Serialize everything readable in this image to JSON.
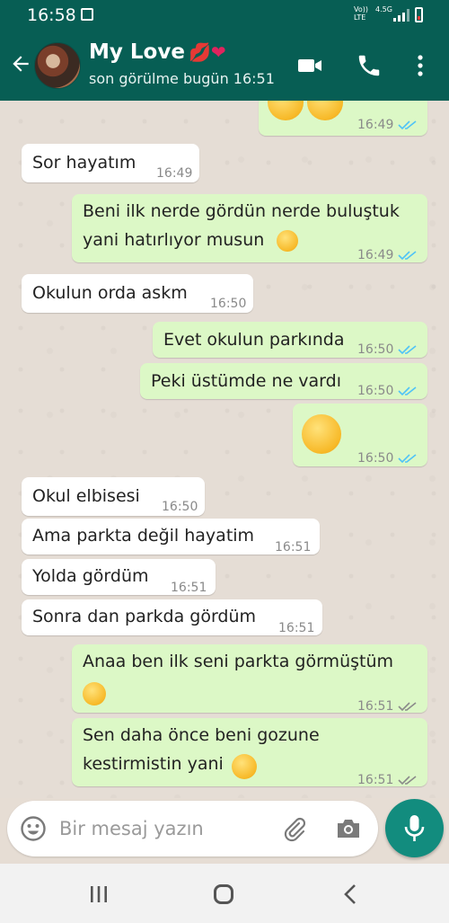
{
  "status_bar": {
    "time": "16:58",
    "net_line1": "Vo))",
    "net_line2": "LTE",
    "net_speed": "4.5G"
  },
  "header": {
    "contact_name": "My Love",
    "name_emojis": "💋❤",
    "last_seen": "son görülme bugün 16:51"
  },
  "messages": [
    {
      "dir": "out",
      "text": "",
      "emoji": "heart-eyes-emoji-x2",
      "time": "16:49",
      "ticks": "read"
    },
    {
      "dir": "in",
      "text": "Sor hayatım",
      "time": "16:49"
    },
    {
      "dir": "out",
      "text_line1": "Beni ilk nerde gördün nerde buluştuk",
      "text_line2": "yani hatırlıyor musun",
      "emoji": "raised-eyebrow-emoji",
      "time": "16:49",
      "ticks": "read"
    },
    {
      "dir": "in",
      "text": "Okulun orda askm",
      "time": "16:50"
    },
    {
      "dir": "out",
      "text": "Evet okulun parkında",
      "time": "16:50",
      "ticks": "read"
    },
    {
      "dir": "out",
      "text": "Peki üstümde ne vardı",
      "time": "16:50",
      "ticks": "read"
    },
    {
      "dir": "out",
      "text": "",
      "emoji": "raised-eyebrow-emoji",
      "time": "16:50",
      "ticks": "read"
    },
    {
      "dir": "in",
      "text": "Okul elbisesi",
      "time": "16:50"
    },
    {
      "dir": "in",
      "text": "Ama parkta değil hayatim",
      "time": "16:51"
    },
    {
      "dir": "in",
      "text": "Yolda gördüm",
      "time": "16:51"
    },
    {
      "dir": "in",
      "text": "Sonra dan parkda gördüm",
      "time": "16:51"
    },
    {
      "dir": "out",
      "text_line1": "Anaa ben ilk seni parkta görmüştüm",
      "emoji": "tears-of-joy-emoji",
      "time": "16:51",
      "ticks": "delivered"
    },
    {
      "dir": "out",
      "text_line1": "Sen daha önce beni gozune",
      "text_line2": "kestirmistin yani",
      "emoji": "tears-of-joy-emoji",
      "time": "16:51",
      "ticks": "delivered"
    }
  ],
  "input": {
    "placeholder": "Bir mesaj yazın"
  },
  "colors": {
    "header": "#075e54",
    "outgoing": "#dcf8c6",
    "incoming": "#ffffff",
    "mic": "#128c7e",
    "read_ticks": "#4fc3f7",
    "unread_ticks": "#8a8a8a"
  }
}
